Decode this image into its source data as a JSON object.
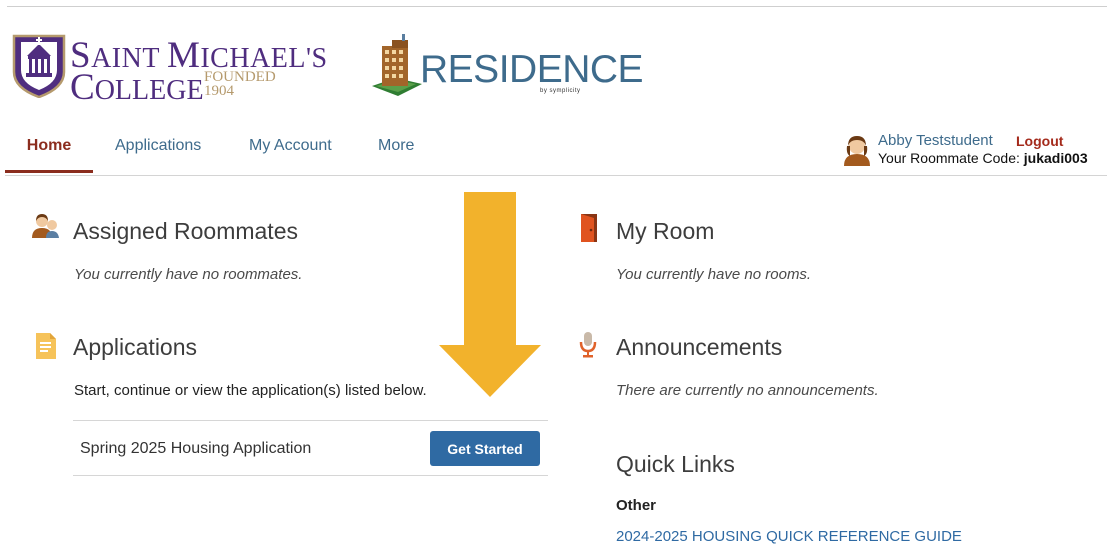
{
  "college_logo": {
    "line1_first": "S",
    "line1_rest": "AINT ",
    "line1_first2": "M",
    "line1_rest2": "ICHAEL'S",
    "line2_first": "C",
    "line2_rest": "OLLEGE",
    "founded": "FOUNDED",
    "year": "1904"
  },
  "residence_logo": {
    "word": "RESIDENCE",
    "by": "by symplicity"
  },
  "nav": {
    "tabs": [
      {
        "label": "Home",
        "active": true
      },
      {
        "label": "Applications",
        "active": false
      },
      {
        "label": "My Account",
        "active": false
      },
      {
        "label": "More",
        "active": false
      }
    ]
  },
  "user": {
    "name": "Abby Teststudent",
    "logout": "Logout",
    "roommate_code_label": "Your Roommate Code: ",
    "roommate_code": "jukadi003"
  },
  "assigned_roommates": {
    "title": "Assigned Roommates",
    "empty": "You currently have no roommates."
  },
  "applications": {
    "title": "Applications",
    "description": "Start, continue or view the application(s) listed below.",
    "items": [
      {
        "name": "Spring 2025 Housing Application",
        "action": "Get Started"
      }
    ]
  },
  "my_room": {
    "title": "My Room",
    "empty": "You currently have no rooms."
  },
  "announcements": {
    "title": "Announcements",
    "empty": "There are currently no announcements."
  },
  "quick_links": {
    "title": "Quick Links",
    "group": "Other",
    "links": [
      "2024-2025 HOUSING QUICK REFERENCE GUIDE"
    ]
  },
  "colors": {
    "brand_purple": "#4f2d7f",
    "gold": "#b59a6d",
    "link_blue": "#3e6b8c",
    "active_tab": "#8b2d1e",
    "button_blue": "#2f6aa3",
    "annotation_arrow": "#f2b22c"
  },
  "icons": {
    "seal": "college-seal-icon",
    "building": "residence-building-icon",
    "user_avatar": "user-avatar-icon",
    "roommates": "roommates-icon",
    "applications": "document-icon",
    "room": "door-icon",
    "announcements": "microphone-icon",
    "annotation": "down-arrow-icon"
  }
}
